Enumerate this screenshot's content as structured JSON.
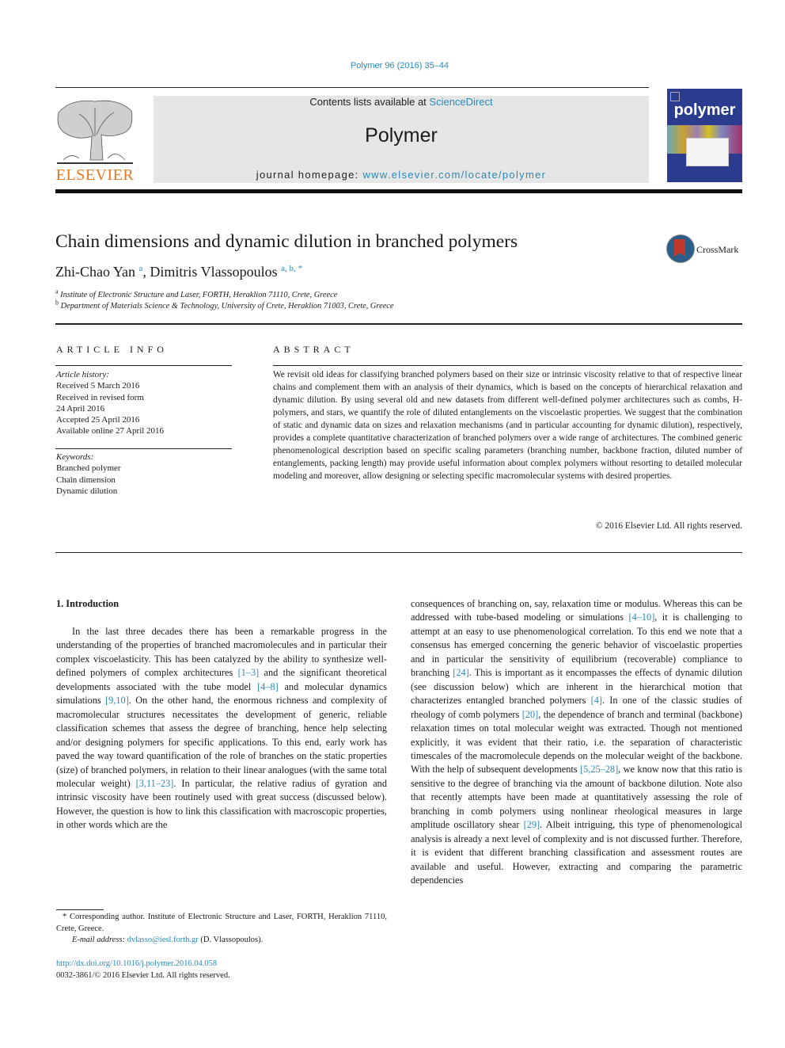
{
  "header": {
    "citation": "Polymer 96 (2016) 35–44",
    "contents_prefix": "Contents lists available at ",
    "contents_link": "ScienceDirect",
    "journal_name": "Polymer",
    "homepage_prefix": "journal homepage: ",
    "homepage_url": "www.elsevier.com/locate/polymer",
    "publisher_logo_text": "ELSEVIER",
    "cover_title": "polymer",
    "colors": {
      "link": "#2a8ab8",
      "elsevier_orange": "#e87722",
      "cover_blue": "#2b3c8e"
    }
  },
  "article": {
    "title": "Chain dimensions and dynamic dilution in branched polymers",
    "crossmark_label": "CrossMark",
    "authors": [
      {
        "name": "Zhi-Chao Yan",
        "affil": "a"
      },
      {
        "name": "Dimitris Vlassopoulos",
        "affil": "a, b, *"
      }
    ],
    "author_separator": ", ",
    "affiliations": [
      {
        "mark": "a",
        "text": "Institute of Electronic Structure and Laser, FORTH, Heraklion 71110, Crete, Greece"
      },
      {
        "mark": "b",
        "text": "Department of Materials Science & Technology, University of Crete, Heraklion 71003, Crete, Greece"
      }
    ]
  },
  "article_info": {
    "heading": "ARTICLE INFO",
    "history_label": "Article history:",
    "history": [
      "Received 5 March 2016",
      "Received in revised form",
      "24 April 2016",
      "Accepted 25 April 2016",
      "Available online 27 April 2016"
    ],
    "keywords_label": "Keywords:",
    "keywords": [
      "Branched polymer",
      "Chain dimension",
      "Dynamic dilution"
    ]
  },
  "abstract": {
    "heading": "ABSTRACT",
    "text": "We revisit old ideas for classifying branched polymers based on their size or intrinsic viscosity relative to that of respective linear chains and complement them with an analysis of their dynamics, which is based on the concepts of hierarchical relaxation and dynamic dilution. By using several old and new datasets from different well-defined polymer architectures such as combs, H-polymers, and stars, we quantify the role of diluted entanglements on the viscoelastic properties. We suggest that the combination of static and dynamic data on sizes and relaxation mechanisms (and in particular accounting for dynamic dilution), respectively, provides a complete quantitative characterization of branched polymers over a wide range of architectures. The combined generic phenomenological description based on specific scaling parameters (branching number, backbone fraction, diluted number of entanglements, packing length) may provide useful information about complex polymers without resorting to detailed molecular modeling and moreover, allow designing or selecting specific macromolecular systems with desired properties.",
    "copyright": "© 2016 Elsevier Ltd. All rights reserved."
  },
  "introduction": {
    "heading": "1.  Introduction",
    "left": [
      {
        "t": "In the last three decades there has been a remarkable progress in the understanding of the properties of branched macromolecules and in particular their complex viscoelasticity. This has been catalyzed by the ability to synthesize well-defined polymers of complex architectures "
      },
      {
        "ref": "[1–3]"
      },
      {
        "t": " and the significant theoretical developments associated with the tube model "
      },
      {
        "ref": "[4–8]"
      },
      {
        "t": " and molecular dynamics simulations "
      },
      {
        "ref": "[9,10]"
      },
      {
        "t": ". On the other hand, the enormous richness and complexity of macromolecular structures necessitates the development of generic, reliable classification schemes that assess the degree of branching, hence help selecting and/or designing polymers for specific applications. To this end, early work has paved the way toward quantification of the role of branches on the static properties (size) of branched polymers, in relation to their linear analogues (with the same total molecular weight) "
      },
      {
        "ref": "[3,11–23]"
      },
      {
        "t": ". In particular, the relative radius of gyration and intrinsic viscosity have been routinely used with great success (discussed below). However, the question is how to link this classification with macroscopic properties, in other words which are the"
      }
    ],
    "right": [
      {
        "t": "consequences of branching on, say, relaxation time or modulus. Whereas this can be addressed with tube-based modeling or simulations "
      },
      {
        "ref": "[4–10]"
      },
      {
        "t": ", it is challenging to attempt at an easy to use phenomenological correlation. To this end we note that a consensus has emerged concerning the generic behavior of viscoelastic properties and in particular the sensitivity of equilibrium (recoverable) compliance to branching "
      },
      {
        "ref": "[24]"
      },
      {
        "t": ". This is important as it encompasses the effects of dynamic dilution (see discussion below) which are inherent in the hierarchical motion that characterizes entangled branched polymers "
      },
      {
        "ref": "[4]"
      },
      {
        "t": ". In one of the classic studies of rheology of comb polymers "
      },
      {
        "ref": "[20]"
      },
      {
        "t": ", the dependence of branch and terminal (backbone) relaxation times on total molecular weight was extracted. Though not mentioned explicitly, it was evident that their ratio, i.e. the separation of characteristic timescales of the macromolecule depends on the molecular weight of the backbone. With the help of subsequent developments "
      },
      {
        "ref": "[5,25–28]"
      },
      {
        "t": ", we know now that this ratio is sensitive to the degree of branching via the amount of backbone dilution. Note also that recently attempts have been made at quantitatively assessing the role of branching in comb polymers using nonlinear rheological measures in large amplitude oscillatory shear "
      },
      {
        "ref": "[29]"
      },
      {
        "t": ". Albeit intriguing, this type of phenomenological analysis is already a next level of complexity and is not discussed further. Therefore, it is evident that different branching classification and assessment routes are available and useful. However, extracting and comparing the parametric dependencies"
      }
    ]
  },
  "footer": {
    "footnote_mark": "*",
    "footnote_text": " Corresponding author. Institute of Electronic Structure and Laser, FORTH, Heraklion 71110, Crete, Greece.",
    "email_label": "E-mail address: ",
    "email": "dvlasso@iesl.forth.gr",
    "email_suffix": " (D. Vlassopoulos).",
    "doi": "http://dx.doi.org/10.1016/j.polymer.2016.04.058",
    "issn": "0032-3861/© 2016 Elsevier Ltd. All rights reserved."
  }
}
